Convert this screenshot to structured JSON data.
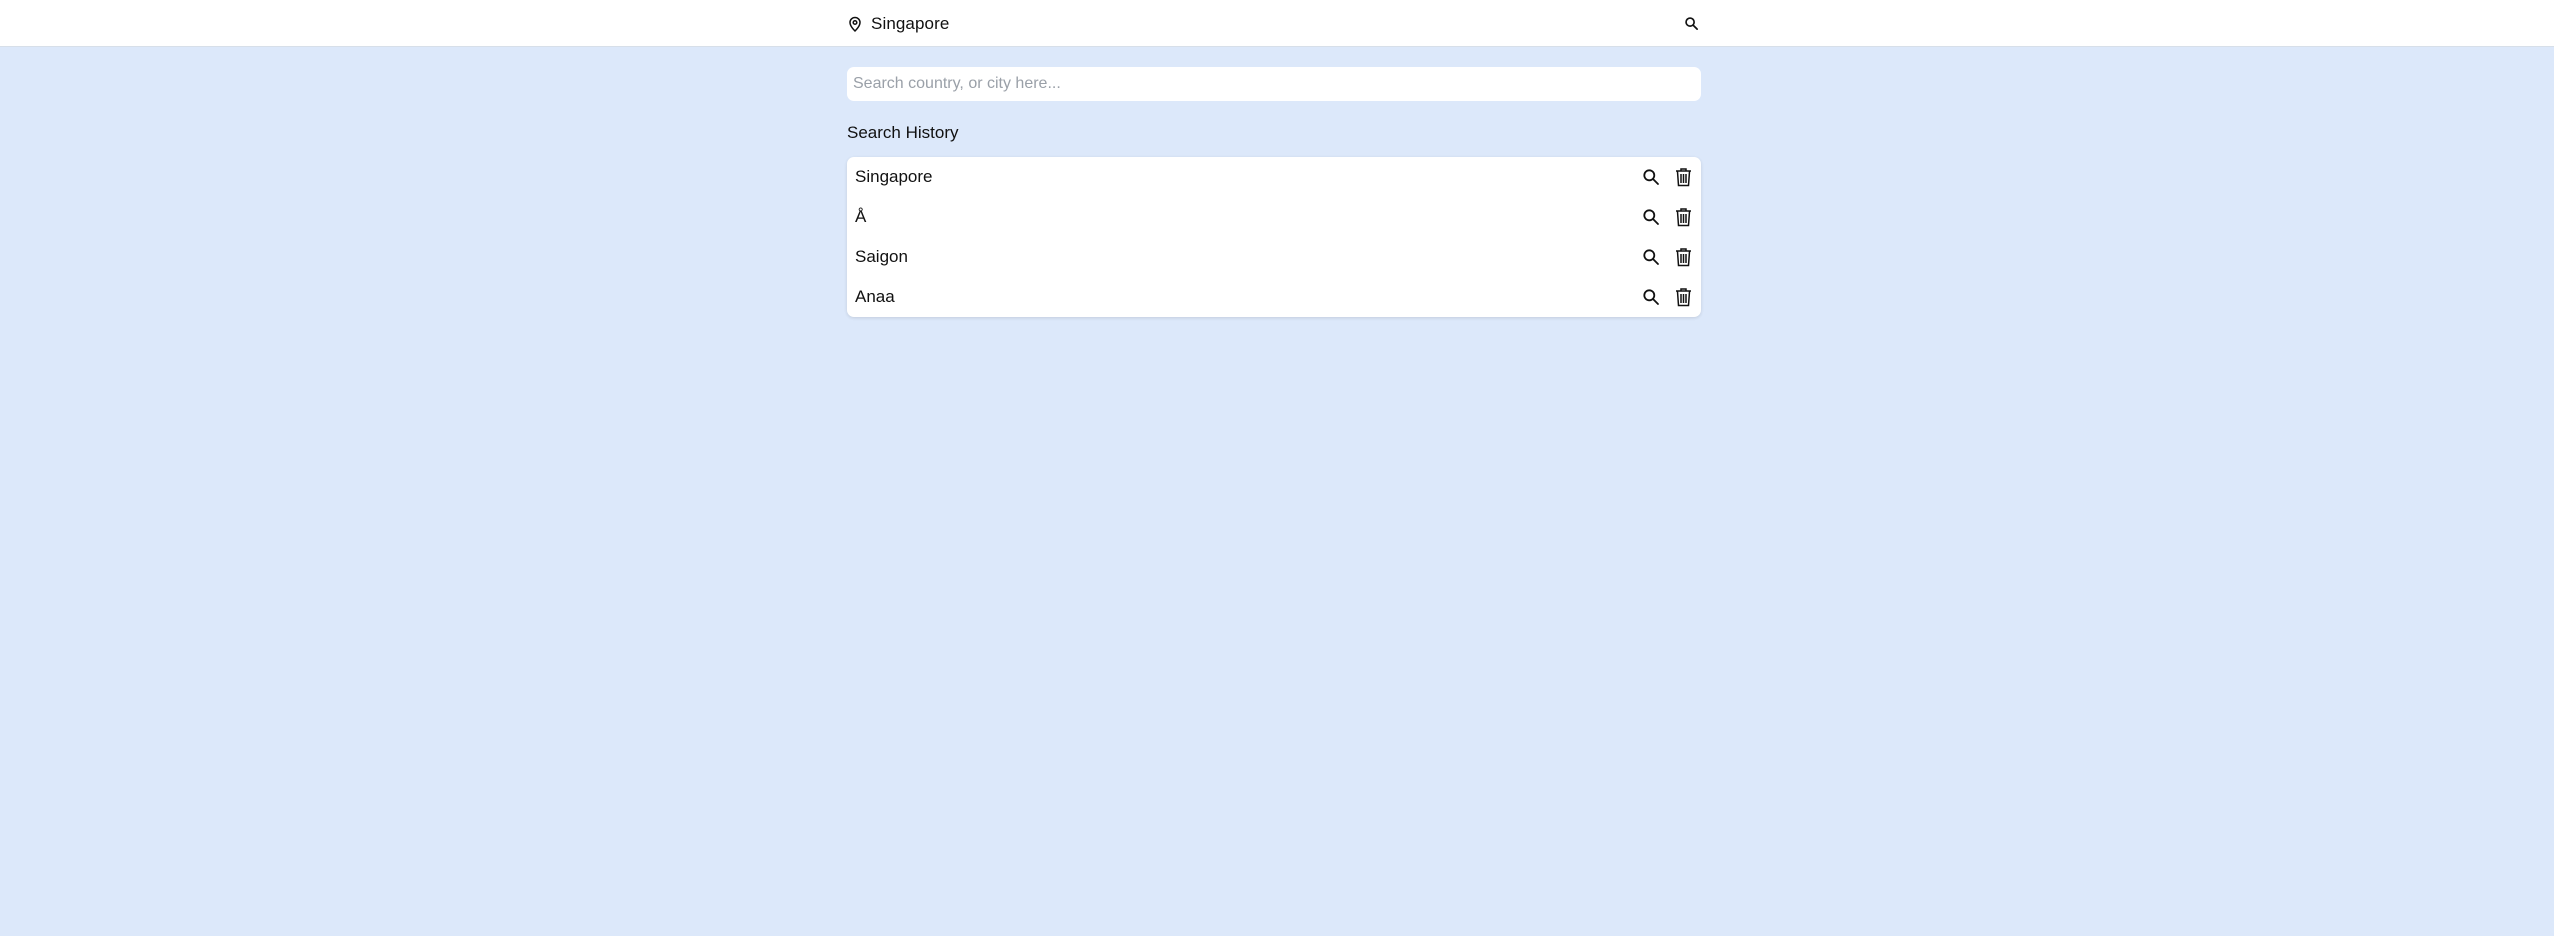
{
  "header": {
    "location_icon": "map-pin-icon",
    "location_name": "Singapore",
    "search_icon": "search-icon"
  },
  "search": {
    "value": "",
    "placeholder": "Search country, or city here..."
  },
  "history": {
    "title": "Search History",
    "items": [
      {
        "label": "Singapore",
        "search_icon": "search-icon",
        "delete_icon": "trash-icon"
      },
      {
        "label": "Å",
        "search_icon": "search-icon",
        "delete_icon": "trash-icon"
      },
      {
        "label": "Saigon",
        "search_icon": "search-icon",
        "delete_icon": "trash-icon"
      },
      {
        "label": "Anaa",
        "search_icon": "search-icon",
        "delete_icon": "trash-icon"
      }
    ]
  },
  "colors": {
    "page_background": "#dce8fa",
    "surface": "#ffffff",
    "text": "#111111",
    "placeholder": "#9aa0a8"
  }
}
